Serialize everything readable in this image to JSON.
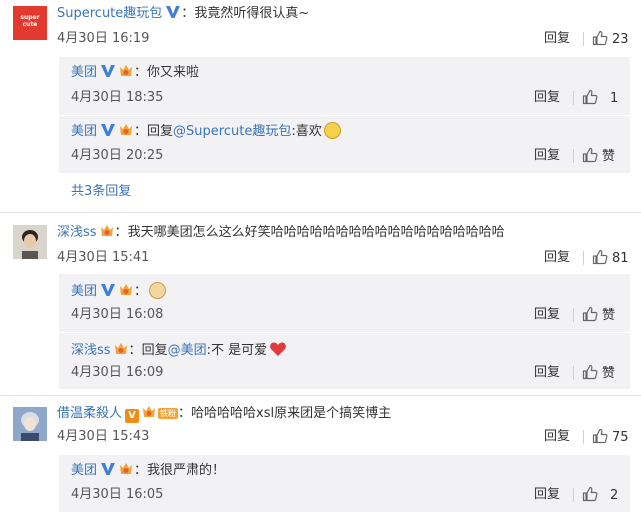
{
  "comments": [
    {
      "user": "Supercute趣玩包",
      "avatar_text": "super cute",
      "content": "我竟然听得很认真~",
      "time": "4月30日 16:19",
      "reply_label": "回复",
      "likes": "23",
      "replies": [
        {
          "user": "美团",
          "content": "你又来啦",
          "time": "4月30日 18:35",
          "reply_label": "回复",
          "likes": "1"
        },
        {
          "user": "美团",
          "reply_prefix": "回复",
          "mention": "@Supercute趣玩包",
          "content": ":喜欢",
          "time": "4月30日 20:25",
          "reply_label": "回复",
          "likes": "赞"
        }
      ],
      "more_replies": "共3条回复"
    },
    {
      "user": "深浅ss",
      "content": "我天哪美团怎么这么好笑哈哈哈哈哈哈哈哈哈哈哈哈哈哈哈哈哈哈",
      "time": "4月30日 15:41",
      "reply_label": "回复",
      "likes": "81",
      "replies": [
        {
          "user": "美团",
          "content": "",
          "time": "4月30日 16:08",
          "reply_label": "回复",
          "likes": "赞"
        },
        {
          "user": "深浅ss",
          "reply_prefix": "回复",
          "mention": "@美团",
          "content": ":不 是可爱",
          "time": "4月30日 16:09",
          "reply_label": "回复",
          "likes": "赞"
        }
      ]
    },
    {
      "user": "借温柔殺人",
      "fan_tag": "铁粉",
      "content": "哈哈哈哈哈xsl原来团是个搞笑博主",
      "time": "4月30日 15:43",
      "reply_label": "回复",
      "likes": "75",
      "replies": [
        {
          "user": "美团",
          "content": "我很严肃的！",
          "time": "4月30日 16:05",
          "reply_label": "回复",
          "likes": "2"
        }
      ]
    }
  ],
  "icons": {
    "verified": "verified-v-icon",
    "medal": "fan-medal-icon",
    "like": "thumbs-up-icon"
  },
  "colors": {
    "link": "#3a74b8",
    "verified": "#3f7fd6",
    "reply_bg": "#f2f2f5",
    "brand_red": "#e23a2e",
    "heart": "#e0393e"
  }
}
